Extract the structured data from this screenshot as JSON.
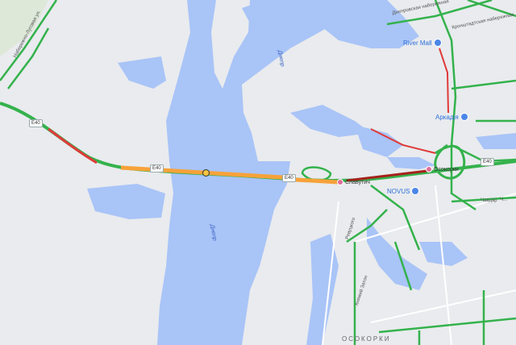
{
  "map": {
    "water_color": "#a9c4f7",
    "land_color": "#e9ebee",
    "park_color": "#dde8d8",
    "traffic_colors": {
      "fast": "#34b24c",
      "medium": "#f7a23a",
      "slow": "#e03a3a",
      "very_slow": "#a5221b"
    },
    "rivers": [
      {
        "name": "Днепр"
      },
      {
        "name": "Днепр"
      }
    ],
    "road_shields": [
      "E40",
      "E40",
      "E40",
      "E40"
    ],
    "pois": [
      {
        "name": "River Mall",
        "icon": "shopping-icon"
      },
      {
        "name": "Аркадія",
        "icon": "shopping-icon"
      },
      {
        "name": "NOVUS",
        "icon": "shopping-icon"
      },
      {
        "name": "Славутич",
        "icon": "metro-icon"
      },
      {
        "name": "Осокорки",
        "icon": "metro-icon"
      }
    ],
    "streets": [
      "Набережно-Луговая ул.",
      "Днепровская набережная",
      "Кронштадтская набережная",
      "Ревуцкого",
      "Княжий Затон",
      "Ч...",
      "Чавдар"
    ],
    "districts": [
      "ОСОКОРКИ"
    ],
    "incidents": [
      {
        "type": "accident",
        "icon": "warning-icon"
      }
    ]
  }
}
